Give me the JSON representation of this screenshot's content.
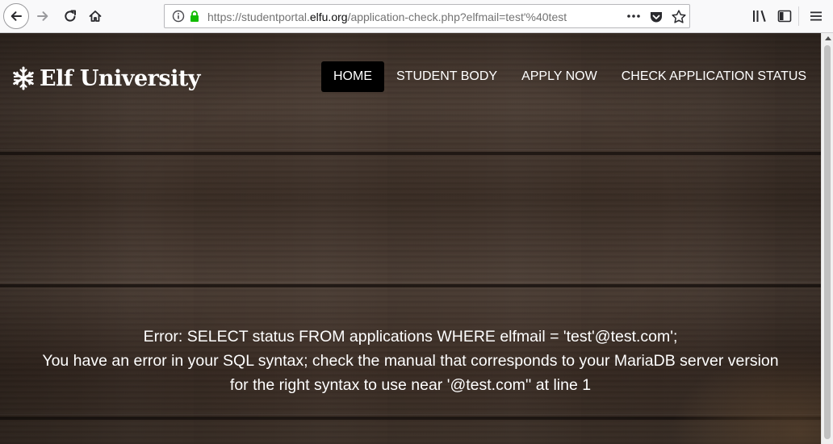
{
  "browser": {
    "url_prefix": "https://studentportal.",
    "url_domain": "elfu.org",
    "url_suffix": "/application-check.php?elfmail=test'%40test",
    "icons": {
      "back": "back-arrow-icon",
      "forward": "forward-arrow-icon",
      "reload": "reload-icon",
      "home": "home-icon",
      "info": "info-icon",
      "lock": "lock-icon",
      "page_actions": "more-dots-icon",
      "pocket": "pocket-icon",
      "bookmark": "star-icon",
      "library": "library-icon",
      "sidebar": "sidebar-icon",
      "menu": "hamburger-menu-icon"
    },
    "accent_lock_color": "#12bc00"
  },
  "site": {
    "brand": "Elf University",
    "nav": [
      {
        "label": "HOME",
        "active": true
      },
      {
        "label": "STUDENT BODY",
        "active": false
      },
      {
        "label": "APPLY NOW",
        "active": false
      },
      {
        "label": "CHECK APPLICATION STATUS",
        "active": false
      }
    ],
    "active_color": "#000000"
  },
  "error": {
    "line1": "Error: SELECT status FROM applications WHERE elfmail = 'test'@test.com';",
    "line2": "You have an error in your SQL syntax; check the manual that corresponds to your MariaDB server version",
    "line3": "for the right syntax to use near '@test.com'' at line 1"
  }
}
